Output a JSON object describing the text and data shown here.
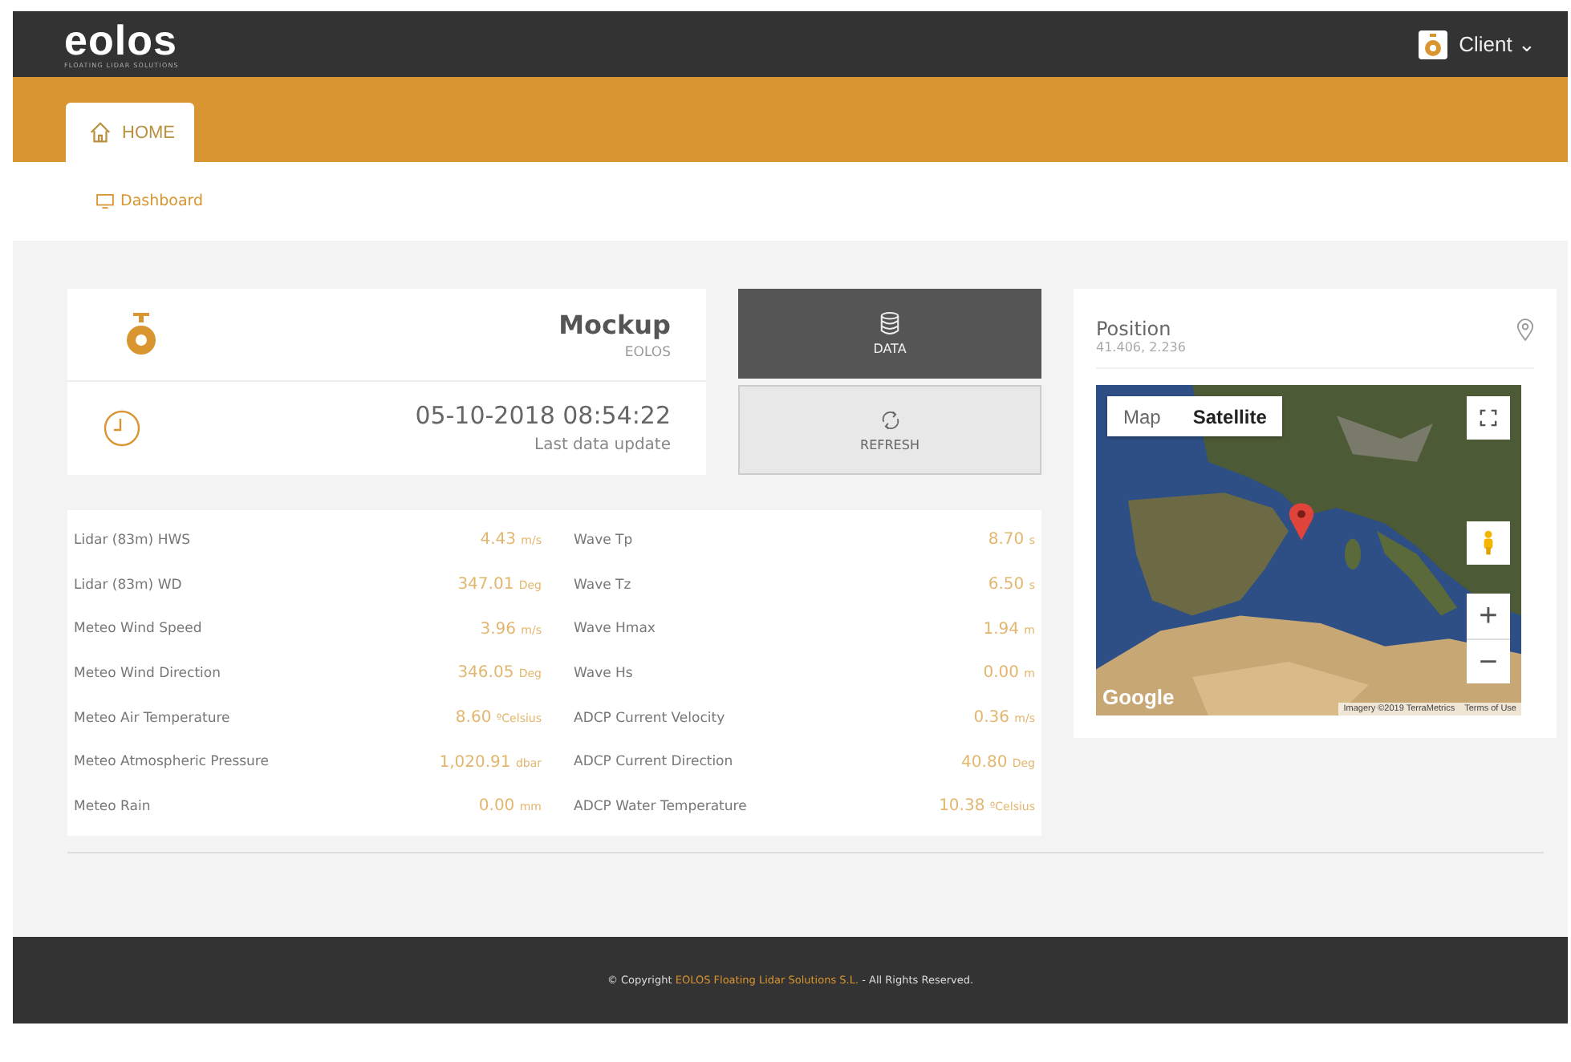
{
  "header": {
    "logo": "eolos",
    "tagline": "FLOATING LIDAR SOLUTIONS",
    "user": "Client",
    "caret": "⌄"
  },
  "tabs": [
    {
      "label": "HOME",
      "selected": true
    }
  ],
  "breadcrumb": "Dashboard",
  "device": {
    "name": "Mockup",
    "owner": "EOLOS",
    "timestamp": "05-10-2018 08:54:22",
    "timestamp_label": "Last data update"
  },
  "actions": [
    {
      "label": "DATA",
      "selected": true
    },
    {
      "label": "REFRESH",
      "selected": false
    }
  ],
  "readings": [
    {
      "label": "Lidar (83m) HWS",
      "value": "4.43",
      "unit": "m/s"
    },
    {
      "label": "Wave Tp",
      "value": "8.70",
      "unit": "s"
    },
    {
      "label": "Lidar (83m) WD",
      "value": "347.01",
      "unit": "Deg"
    },
    {
      "label": "Wave Tz",
      "value": "6.50",
      "unit": "s"
    },
    {
      "label": "Meteo Wind Speed",
      "value": "3.96",
      "unit": "m/s"
    },
    {
      "label": "Wave Hmax",
      "value": "1.94",
      "unit": "m"
    },
    {
      "label": "Meteo Wind Direction",
      "value": "346.05",
      "unit": "Deg"
    },
    {
      "label": "Wave Hs",
      "value": "0.00",
      "unit": "m"
    },
    {
      "label": "Meteo Air Temperature",
      "value": "8.60",
      "unit": "ºCelsius"
    },
    {
      "label": "ADCP Current Velocity",
      "value": "0.36",
      "unit": "m/s"
    },
    {
      "label": "Meteo Atmospheric Pressure",
      "value": "1,020.91",
      "unit": "dbar"
    },
    {
      "label": "ADCP Current Direction",
      "value": "40.80",
      "unit": "Deg"
    },
    {
      "label": "Meteo Rain",
      "value": "0.00",
      "unit": "mm"
    },
    {
      "label": "ADCP Water Temperature",
      "value": "10.38",
      "unit": "ºCelsius"
    }
  ],
  "position": {
    "title": "Position",
    "coords": "41.406, 2.236",
    "map": {
      "map_types": [
        {
          "label": "Map",
          "selected": false
        },
        {
          "label": "Satellite",
          "selected": true
        }
      ],
      "zoom_in": "+",
      "zoom_out": "−",
      "provider": "Google",
      "attribution": "Imagery ©2019 TerraMetrics",
      "terms": "Terms of Use"
    }
  },
  "footer": {
    "prefix": "© Copyright ",
    "company": "EOLOS Floating Lidar Solutions S.L.",
    "suffix": " - All Rights Reserved."
  }
}
